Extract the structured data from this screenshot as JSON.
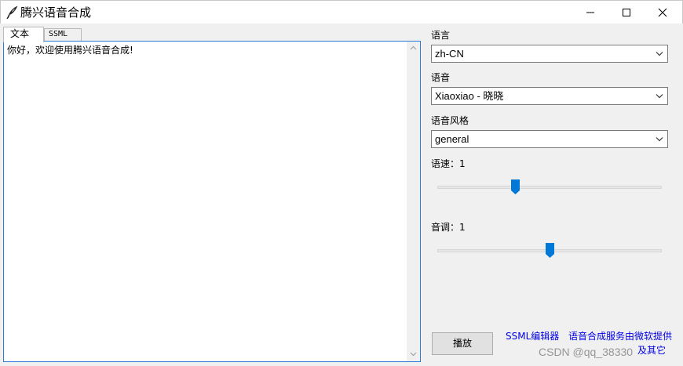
{
  "window": {
    "title": "腾兴语音合成",
    "icon": "feather-icon",
    "controls": [
      "minimize-icon",
      "maximize-icon",
      "close-icon"
    ]
  },
  "tabs": [
    {
      "label": "文本",
      "active": true
    },
    {
      "label": "SSML",
      "active": false
    }
  ],
  "editor": {
    "text": "你好，欢迎使用腾兴语音合成!"
  },
  "settings": {
    "language": {
      "label": "语言",
      "value": "zh-CN"
    },
    "voice": {
      "label": "语音",
      "value": "Xiaoxiao - 晓晓"
    },
    "style": {
      "label": "语音风格",
      "value": "general"
    },
    "rate": {
      "label": "语速：1",
      "level": 0.34
    },
    "pitch": {
      "label": "音调：1",
      "level": 0.5
    }
  },
  "actions": {
    "play": "播放",
    "ssml_editor": "SSML编辑器",
    "powered_by": "语音合成服务由微软提供",
    "powered_by_sub": "及其它"
  },
  "watermark": "CSDN @qq_38330",
  "colors": {
    "accent": "#0078d7",
    "link": "#0000e6",
    "focus_border": "#2d7bd6"
  }
}
